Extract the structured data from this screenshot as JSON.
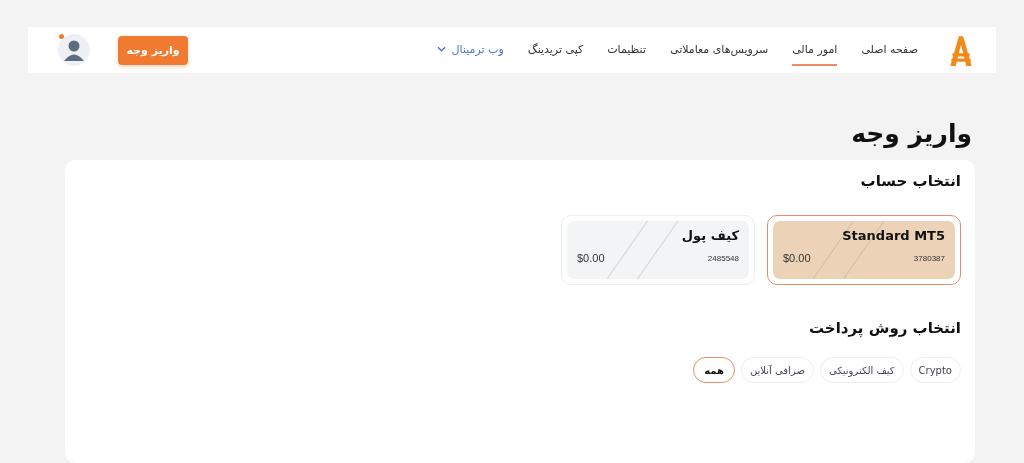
{
  "header": {
    "nav": [
      {
        "label": "صفحه اصلی",
        "selected": false,
        "kind": "link"
      },
      {
        "label": "امور مالی",
        "selected": true,
        "kind": "link"
      },
      {
        "label": "سرویس‌های معاملاتی",
        "selected": false,
        "kind": "link"
      },
      {
        "label": "تنظیمات",
        "selected": false,
        "kind": "link"
      },
      {
        "label": "کپی تریدینگ",
        "selected": false,
        "kind": "link"
      },
      {
        "label": "وب ترمینال",
        "selected": false,
        "kind": "dropdown"
      }
    ],
    "deposit_button": "واریز وجه",
    "notification": true
  },
  "page_title": "واریز وجه",
  "accounts": {
    "heading": "انتخاب حساب",
    "items": [
      {
        "name": "Standard MT5",
        "number": "3780387",
        "balance": "$0.00",
        "selected": true
      },
      {
        "name": "کیف پول",
        "number": "2485548",
        "balance": "$0.00",
        "selected": false
      }
    ]
  },
  "payment": {
    "heading": "انتخاب روش پرداخت",
    "filters": [
      {
        "label": "Crypto",
        "selected": false
      },
      {
        "label": "کیف الکترونیکی",
        "selected": false
      },
      {
        "label": "صرافی آنلاین",
        "selected": false
      },
      {
        "label": "همه",
        "selected": true
      }
    ]
  }
}
